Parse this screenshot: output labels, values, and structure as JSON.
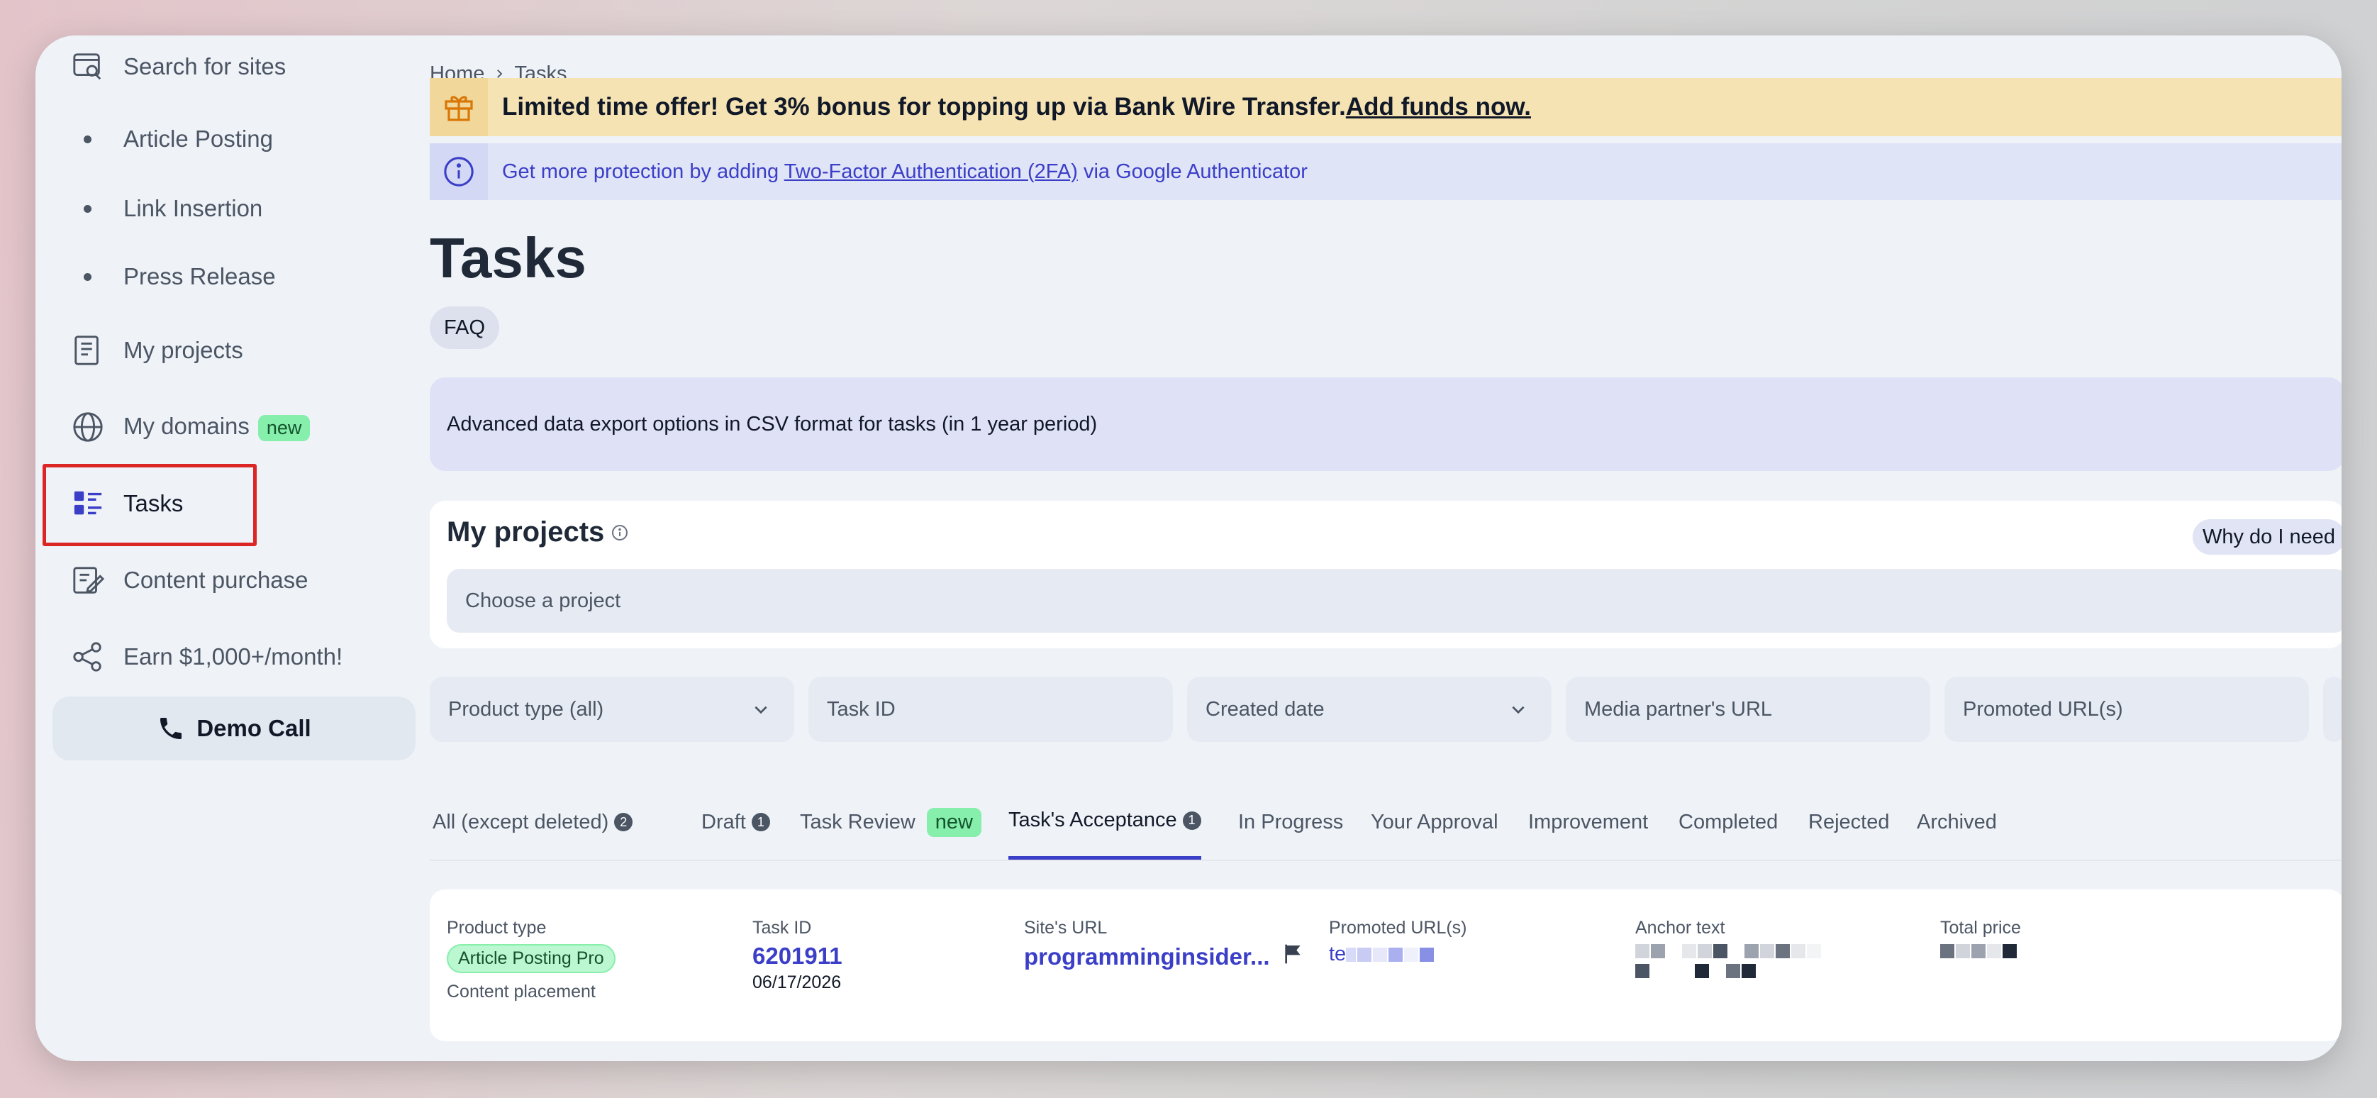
{
  "sidebar": {
    "items": [
      {
        "label": "Search for sites",
        "icon": "search-sites-icon"
      },
      {
        "label": "Article Posting"
      },
      {
        "label": "Link Insertion"
      },
      {
        "label": "Press Release"
      },
      {
        "label": "My projects",
        "icon": "document-icon"
      },
      {
        "label": "My domains",
        "icon": "globe-icon",
        "badge": "new"
      },
      {
        "label": "Tasks",
        "icon": "tasks-icon"
      },
      {
        "label": "Content purchase",
        "icon": "edit-document-icon"
      },
      {
        "label": "Earn $1,000+/month!",
        "icon": "share-icon"
      }
    ],
    "demo_call": "Demo Call"
  },
  "breadcrumb": {
    "home": "Home",
    "current": "Tasks"
  },
  "promo": {
    "text": "Limited time offer! Get 3% bonus for topping up via Bank Wire Transfer.",
    "link": "Add funds now."
  },
  "info": {
    "prefix": "Get more protection by adding ",
    "link": "Two-Factor Authentication (2FA)",
    "suffix": " via Google Authenticator"
  },
  "page_title": "Tasks",
  "faq_label": "FAQ",
  "export_text": "Advanced data export options in CSV format for tasks (in 1 year period)",
  "projects": {
    "title": "My projects",
    "why_button": "Why do I need",
    "placeholder": "Choose a project"
  },
  "filters": {
    "product_type": "Product type (all)",
    "task_id": "Task ID",
    "created_date": "Created date",
    "media_partner_url": "Media partner's URL",
    "promoted_urls": "Promoted URL(s)"
  },
  "tabs": [
    {
      "label": "All (except deleted)",
      "count": "2"
    },
    {
      "label": "Draft",
      "count": "1"
    },
    {
      "label": "Task Review",
      "badge": "new"
    },
    {
      "label": "Task's Acceptance",
      "count": "1",
      "active": true
    },
    {
      "label": "In Progress"
    },
    {
      "label": "Your Approval"
    },
    {
      "label": "Improvement"
    },
    {
      "label": "Completed"
    },
    {
      "label": "Rejected"
    },
    {
      "label": "Archived"
    }
  ],
  "task": {
    "product_type_label": "Product type",
    "product_type_value": "Article Posting Pro",
    "placement": "Content placement",
    "task_id_label": "Task ID",
    "task_id": "6201911",
    "date": "06/17/2026",
    "site_url_label": "Site's URL",
    "site_url": "programminginsider...",
    "promoted_label": "Promoted URL(s)",
    "promoted_prefix": "te",
    "anchor_label": "Anchor text",
    "price_label": "Total price"
  },
  "colors": {
    "accent": "#3b3fc7",
    "highlight": "#dc2626",
    "promo_bg": "#f5e3b4",
    "badge_new": "#86efac"
  }
}
